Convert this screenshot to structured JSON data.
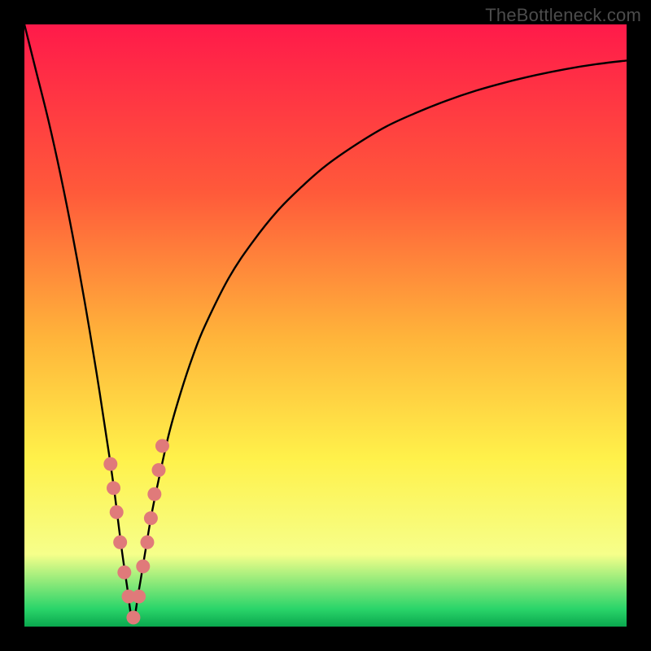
{
  "watermark": "TheBottleneck.com",
  "colors": {
    "frame": "#000000",
    "curve": "#000000",
    "marker_fill": "#e07a7a",
    "marker_stroke": "#b04e4e",
    "grad_top": "#ff1a4a",
    "grad_mid1": "#ff5a3a",
    "grad_mid2": "#ffb43a",
    "grad_mid3": "#fff14a",
    "grad_mid4": "#f6ff8a",
    "grad_bottom": "#2bd56a",
    "grad_bottom_edge": "#0aa84e"
  },
  "chart_data": {
    "type": "line",
    "title": "",
    "xlabel": "",
    "ylabel": "",
    "xlim": [
      0,
      100
    ],
    "ylim": [
      0,
      100
    ],
    "x_notch": 18,
    "series": [
      {
        "name": "bottleneck-curve",
        "x": [
          0,
          2,
          4,
          6,
          8,
          10,
          12,
          14,
          15,
          16,
          17,
          18,
          19,
          20,
          21,
          22,
          24,
          26,
          28,
          30,
          34,
          38,
          42,
          46,
          50,
          55,
          60,
          65,
          70,
          75,
          80,
          85,
          90,
          95,
          100
        ],
        "y": [
          100,
          92,
          84,
          75,
          65,
          54,
          42,
          29,
          22,
          14,
          7,
          1,
          6,
          12,
          18,
          23,
          32,
          39,
          45,
          50,
          58,
          64,
          69,
          73,
          76.5,
          80,
          83,
          85.3,
          87.3,
          89,
          90.4,
          91.6,
          92.6,
          93.4,
          94
        ]
      }
    ],
    "markers": {
      "name": "highlight-points",
      "x": [
        14.3,
        14.8,
        15.3,
        15.9,
        16.6,
        17.3,
        18.1,
        19.0,
        19.7,
        20.4,
        21.0,
        21.6,
        22.3,
        22.9
      ],
      "y": [
        27,
        23,
        19,
        14,
        9,
        5,
        1.5,
        5,
        10,
        14,
        18,
        22,
        26,
        30
      ]
    }
  }
}
